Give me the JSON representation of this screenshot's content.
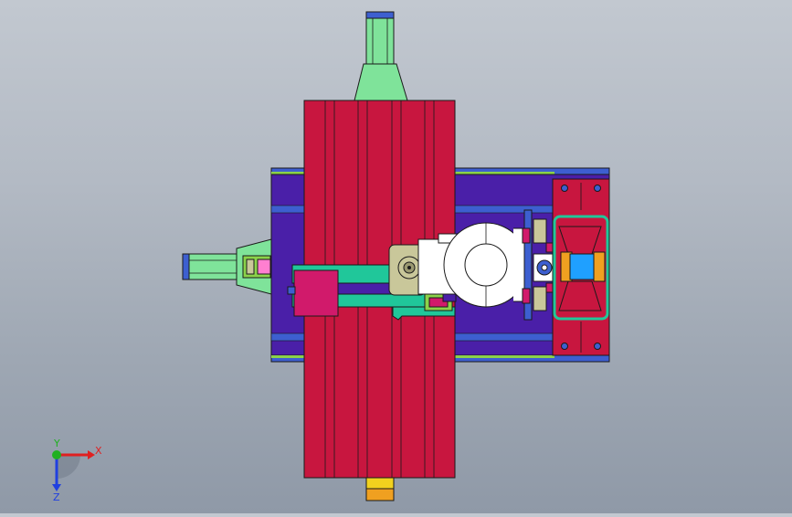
{
  "viewport": {
    "background_top": "#c2c8d0",
    "background_bottom": "#8f99a7"
  },
  "colors": {
    "outline": "#1a1a1a",
    "crimson_slide": "#c8163f",
    "base_purple": "#4a1fa8",
    "base_blue": "#3d5fd0",
    "rail_green": "#8bd24a",
    "mint_green": "#7fe39a",
    "teal_arm": "#20c79a",
    "magenta_block": "#d11a6b",
    "white_disc": "#ffffff",
    "olive_gear": "#c9c79a",
    "orange_part": "#f0a020",
    "yellow_plate": "#f2d21e",
    "cyan_block": "#1fa0ff",
    "clamp_red": "#c8163f",
    "pink_part": "#ff7fd0"
  },
  "axis_triad": {
    "x_label": "X",
    "y_label": "Y",
    "z_label": "Z",
    "x_color": "#e02020",
    "y_color": "#20b020",
    "z_color": "#2040e0"
  }
}
